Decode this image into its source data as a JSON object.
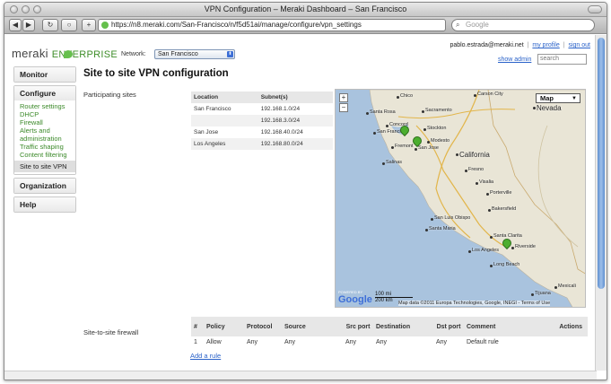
{
  "window": {
    "title": "VPN Configuration – Meraki Dashboard – San Francisco"
  },
  "browser": {
    "url": "https://n8.meraki.com/San-Francisco/n/f5d51ai/manage/configure/vpn_settings",
    "search_placeholder": "Google",
    "buttons": {
      "back": "◀",
      "forward": "▶",
      "reload": "↻",
      "stop": "○",
      "add": "+"
    }
  },
  "header": {
    "brand": "meraki",
    "brand_suffix": "ENTERPRISE",
    "network_label": "Network:",
    "network_value": "San Francisco",
    "user_email": "pablo.estrada@meraki.net",
    "my_profile": "my profile",
    "sign_out": "sign out",
    "show_admin": "show admin",
    "search_placeholder": "search"
  },
  "nav": {
    "monitor": "Monitor",
    "configure": "Configure",
    "configure_items": [
      "Router settings",
      "DHCP",
      "Firewall",
      "Alerts and administration",
      "Traffic shaping",
      "Content filtering",
      "Site to site VPN"
    ],
    "organization": "Organization",
    "help": "Help"
  },
  "main": {
    "title": "Site to site VPN configuration",
    "participating_label": "Participating sites",
    "sites_columns": [
      "Location",
      "Subnet(s)"
    ],
    "sites_rows": [
      {
        "location": "San Francisco",
        "subnet": "192.168.1.0/24"
      },
      {
        "location": "",
        "subnet": "192.168.3.0/24"
      },
      {
        "location": "San Jose",
        "subnet": "192.168.40.0/24"
      },
      {
        "location": "Los Angeles",
        "subnet": "192.168.80.0/24"
      }
    ],
    "map": {
      "type_label": "Map",
      "zoom_in": "+",
      "zoom_out": "−",
      "logo": "Google",
      "powered_by": "POWERED BY",
      "scale_mi": "100 mi",
      "scale_km": "200 km",
      "credit": "Map data ©2011 Europa Technologies, Google, INEGI - Terms of Use",
      "cities": [
        "Chico",
        "Carson City",
        "Nevada",
        "Santa Rosa",
        "Sacramento",
        "Concord",
        "San Francisco",
        "Stockton",
        "Modesto",
        "Fremont",
        "San Jose",
        "Salinas",
        "California",
        "Fresno",
        "Visalia",
        "Porterville",
        "Bakersfield",
        "San Luis Obispo",
        "Santa Maria",
        "Santa Clarita",
        "Los Angeles",
        "Long Beach",
        "Riverside",
        "Mexicali",
        "Tijuana"
      ],
      "markers": [
        "San Francisco",
        "San Jose",
        "Los Angeles"
      ]
    },
    "firewall_label": "Site-to-site firewall",
    "fw_columns": [
      "#",
      "Policy",
      "Protocol",
      "Source",
      "Src port",
      "Destination",
      "Dst port",
      "Comment",
      "Actions"
    ],
    "fw_rows": [
      [
        "1",
        "Allow",
        "Any",
        "Any",
        "Any",
        "Any",
        "Any",
        "Default rule",
        ""
      ]
    ],
    "add_rule": "Add a rule"
  },
  "colors": {
    "accent_green": "#3c8a2a",
    "link_blue": "#2a62c9",
    "ocean": "#a9c3de",
    "land": "#e9e5d6",
    "marker": "#4cae2f"
  }
}
